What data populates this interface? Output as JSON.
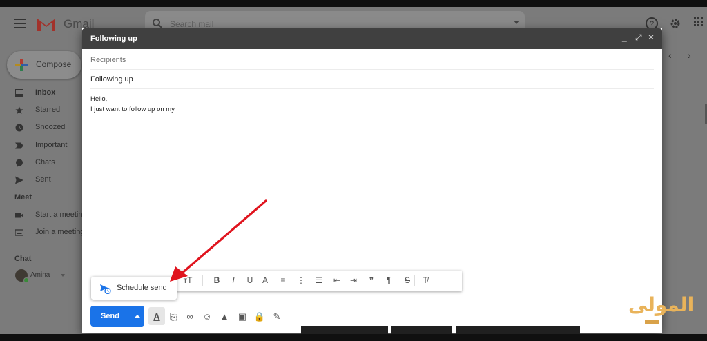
{
  "gmail": {
    "app_name": "Gmail",
    "search_placeholder": "Search mail",
    "compose_label": "Compose",
    "nav": [
      {
        "label": "Inbox",
        "icon": "inbox-icon"
      },
      {
        "label": "Starred",
        "icon": "star-icon"
      },
      {
        "label": "Snoozed",
        "icon": "clock-icon"
      },
      {
        "label": "Important",
        "icon": "important-icon"
      },
      {
        "label": "Chats",
        "icon": "chat-icon"
      },
      {
        "label": "Sent",
        "icon": "send-icon"
      }
    ],
    "meet_heading": "Meet",
    "meet_items": [
      {
        "label": "Start a meeting",
        "icon": "video-icon"
      },
      {
        "label": "Join a meeting",
        "icon": "keyboard-icon"
      }
    ],
    "chat_heading": "Chat",
    "chat_user": "Amina",
    "nav_prev": "‹",
    "nav_next": "›"
  },
  "compose": {
    "title": "Following up",
    "minimize": "_",
    "fullscreen": "⤢",
    "close": "✕",
    "recipients_placeholder": "Recipients",
    "subject": "Following up",
    "body_line1": "Hello,",
    "body_line2": "I just want to follow up on my",
    "schedule_send": "Schedule send",
    "send_label": "Send"
  },
  "formatting": [
    {
      "name": "font-size-button",
      "glyph": "ᴛT"
    },
    {
      "name": "bold-button",
      "glyph": "B"
    },
    {
      "name": "italic-button",
      "glyph": "I"
    },
    {
      "name": "underline-button",
      "glyph": "U"
    },
    {
      "name": "text-color-button",
      "glyph": "A"
    },
    {
      "name": "align-button",
      "glyph": "≡"
    },
    {
      "name": "numbered-list-button",
      "glyph": "⋮"
    },
    {
      "name": "bulleted-list-button",
      "glyph": "☰"
    },
    {
      "name": "indent-less-button",
      "glyph": "⇤"
    },
    {
      "name": "indent-more-button",
      "glyph": "⇥"
    },
    {
      "name": "quote-button",
      "glyph": "❞"
    },
    {
      "name": "rtl-button",
      "glyph": "¶"
    },
    {
      "name": "strikethrough-button",
      "glyph": "S"
    },
    {
      "name": "remove-formatting-button",
      "glyph": "T̸"
    }
  ],
  "bottom_tools": [
    {
      "name": "formatting-options-button",
      "glyph": "A"
    },
    {
      "name": "attach-icon",
      "glyph": "⎘"
    },
    {
      "name": "link-icon",
      "glyph": "∞"
    },
    {
      "name": "emoji-icon",
      "glyph": "☺"
    },
    {
      "name": "drive-icon",
      "glyph": "▲"
    },
    {
      "name": "photo-icon",
      "glyph": "▣"
    },
    {
      "name": "confidential-icon",
      "glyph": "🔒"
    },
    {
      "name": "signature-icon",
      "glyph": "✎"
    }
  ],
  "watermark": "المولى",
  "colors": {
    "send": "#1a73e8",
    "header": "#404040",
    "annotation_arrow": "#e0141e"
  }
}
